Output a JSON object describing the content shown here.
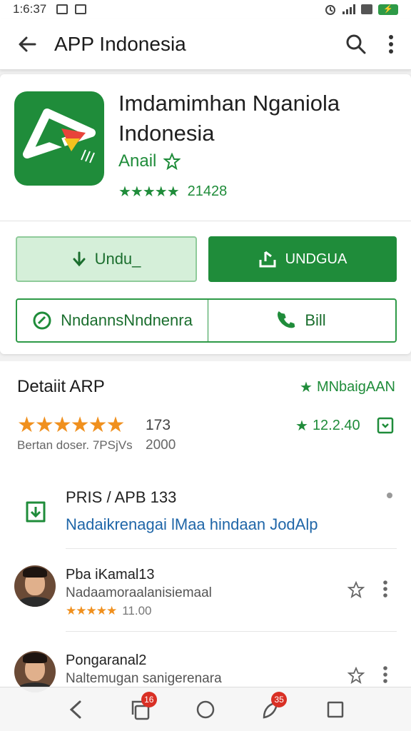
{
  "status_bar": {
    "time": "1:6:37",
    "battery_label": ""
  },
  "app_bar": {
    "title": "APP Indonesia"
  },
  "app": {
    "name": "Imdamimhan Nganiola Indonesia",
    "publisher": "Anail",
    "rating_count": "21428"
  },
  "buttons": {
    "download_light": "Undu_",
    "download_dark": "UNDGUA",
    "share": "NndannsNndnenra",
    "bill": "Bill"
  },
  "detail": {
    "title": "Detaiit ARP",
    "tag": "MNbaigAAN",
    "rating": "173",
    "rating_caption": "Bertan doser. 7PSjVs",
    "rating_caption2": "2000",
    "downloads": "12.2.40"
  },
  "pris": {
    "label": "PRIS / APB 133",
    "link": "Nadaikrenagai lMaa hindaan JodAlp"
  },
  "reviews": [
    {
      "name": "Pba iKamal13",
      "text": "Nadaamoraalanisiemaal",
      "value": "11.00"
    },
    {
      "name": "Pongaranal2",
      "text": "Naltemugan sanigerenara",
      "value": ""
    }
  ],
  "nav": {
    "badges": [
      "16",
      "35"
    ]
  },
  "colors": {
    "accent": "#1f8c3a",
    "star_orange": "#f0901e",
    "link_blue": "#1f66a8",
    "badge_red": "#d93025"
  },
  "icons": [
    "back-arrow-icon",
    "search-icon",
    "more-vert-icon",
    "download-icon",
    "share-icon",
    "phone-icon",
    "star-icon",
    "bookmark-icon",
    "download-box-icon",
    "back-nav-icon",
    "recents-icon",
    "home-icon",
    "app-icon"
  ]
}
